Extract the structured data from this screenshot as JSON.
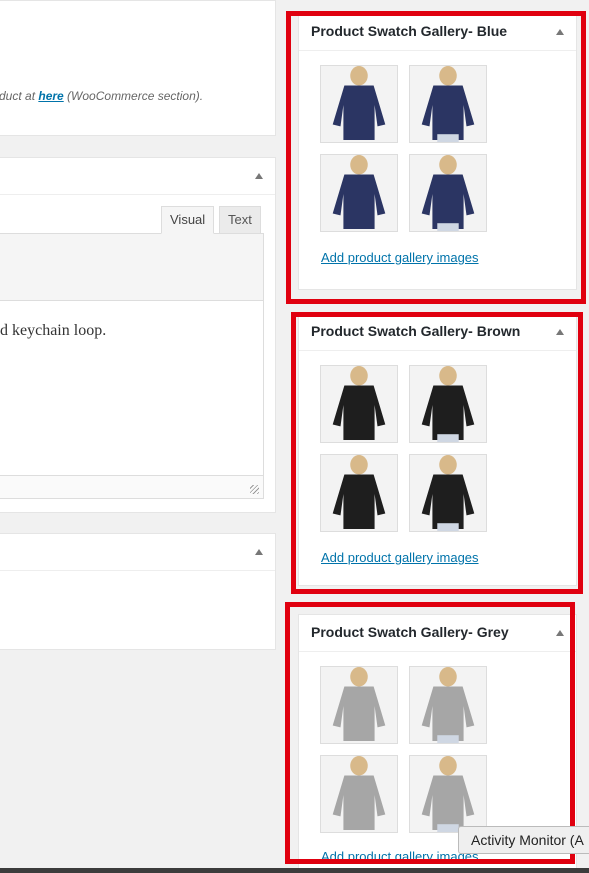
{
  "left": {
    "notice_prefix": "duct at ",
    "notice_link": "here",
    "notice_suffix": " (WooCommerce section).",
    "editor_tabs": {
      "visual": "Visual",
      "text": "Text"
    },
    "editor_content": "d keychain loop."
  },
  "galleries": [
    {
      "title": "Product Swatch Gallery- Blue",
      "color": "#2b3563",
      "add_link": "Add product gallery images"
    },
    {
      "title": "Product Swatch Gallery- Brown",
      "color": "#1e1e1e",
      "add_link": "Add product gallery images"
    },
    {
      "title": "Product Swatch Gallery- Grey",
      "color": "#a6a6a6",
      "add_link": "Add product gallery images"
    }
  ],
  "tooltip": "Activity Monitor (A"
}
